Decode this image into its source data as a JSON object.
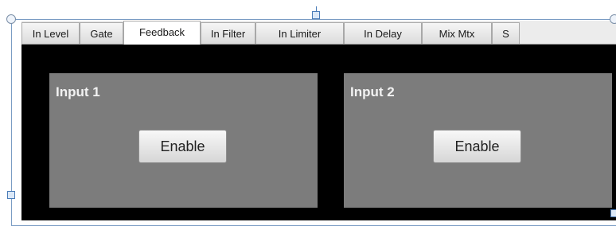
{
  "tabs": [
    {
      "label": "In Level",
      "active": false
    },
    {
      "label": "Gate",
      "active": false
    },
    {
      "label": "Feedback",
      "active": true
    },
    {
      "label": "In Filter",
      "active": false
    },
    {
      "label": "In Limiter",
      "active": false
    },
    {
      "label": "In Delay",
      "active": false
    },
    {
      "label": "Mix Mtx",
      "active": false
    },
    {
      "label": "S",
      "active": false
    }
  ],
  "panels": [
    {
      "title": "Input 1",
      "button_label": "Enable"
    },
    {
      "title": "Input 2",
      "button_label": "Enable"
    }
  ],
  "colors": {
    "content_background": "#000000",
    "panel_background": "#7c7c7c",
    "selection_handle": "#4a7cb8"
  }
}
